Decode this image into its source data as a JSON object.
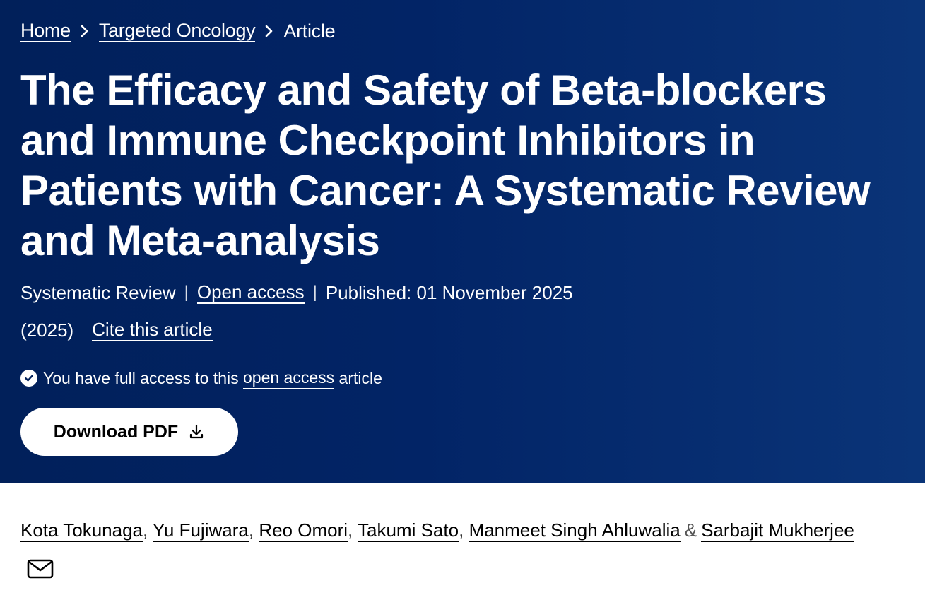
{
  "breadcrumb": {
    "items": [
      "Home",
      "Targeted Oncology",
      "Article"
    ]
  },
  "article": {
    "title": "The Efficacy and Safety of Beta-blockers and Immune Checkpoint Inhibitors in Patients with Cancer: A Systematic Review and Meta-analysis",
    "type": "Systematic Review",
    "open_access_label": "Open access",
    "published": "Published: 01 November 2025",
    "year": "(2025)",
    "cite_label": "Cite this article",
    "access_prefix": "You have full access to this",
    "access_link": "open access",
    "access_suffix": "article",
    "download_label": "Download PDF"
  },
  "authors": {
    "names": [
      "Kota Tokunaga",
      "Yu Fujiwara",
      "Reo Omori",
      "Takumi Sato",
      "Manmeet Singh Ahluwalia",
      "Sarbajit Mukherjee"
    ],
    "separator": ",",
    "ampersand": "&"
  },
  "colors": {
    "hero_background": "#01205a",
    "hero_text": "#ffffff",
    "button_background": "#ffffff"
  },
  "icons": [
    "chevron-right-icon",
    "check-circle-icon",
    "download-icon",
    "mail-icon"
  ]
}
